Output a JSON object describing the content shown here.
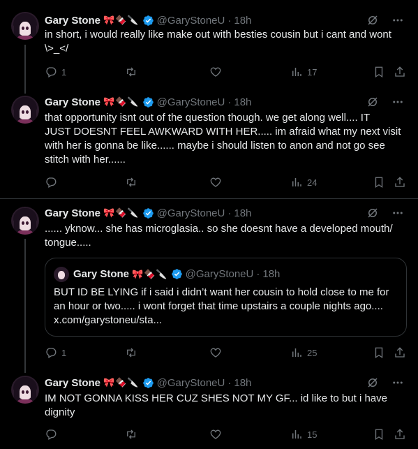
{
  "user": {
    "name": "Gary Stone",
    "emojis": "🎀🍫🔪",
    "handle": "@GaryStoneU",
    "time": "18h"
  },
  "tweets": [
    {
      "text_lines": [
        "in short, i would really like make out with besties cousin but i cant and wont",
        "\\>_</"
      ],
      "reply_count": "1",
      "views": "17"
    },
    {
      "text_lines": [
        "that opportunity isnt out of the question though. we get along well.... IT",
        "JUST DOESNT FEEL AWKWARD WITH HER..... im afraid what my next visit",
        "with her is gonna be like...... maybe i should listen to anon and not go see",
        "stitch with her......"
      ],
      "reply_count": "",
      "views": "24"
    },
    {
      "text_lines": [
        "...... yknow... she has microglasia.. so she doesnt have a developed mouth/",
        "tongue....."
      ],
      "reply_count": "1",
      "views": "25",
      "quote": {
        "text_lines": [
          "BUT ID BE LYING if i said i didn’t want her cousin to hold close to me for",
          "an hour or two..... i wont forget that time upstairs a couple nights ago....",
          "x.com/garystoneu/sta..."
        ]
      }
    },
    {
      "text_lines": [
        "IM NOT GONNA KISS HER CUZ SHES NOT MY GF... id like to but i have",
        "dignity"
      ],
      "reply_count": "",
      "views": "15"
    }
  ],
  "colors": {
    "background": "#000000",
    "text": "#e7e9ea",
    "muted": "#71767b",
    "verified": "#1d9bf0",
    "divider": "#2f3336"
  }
}
